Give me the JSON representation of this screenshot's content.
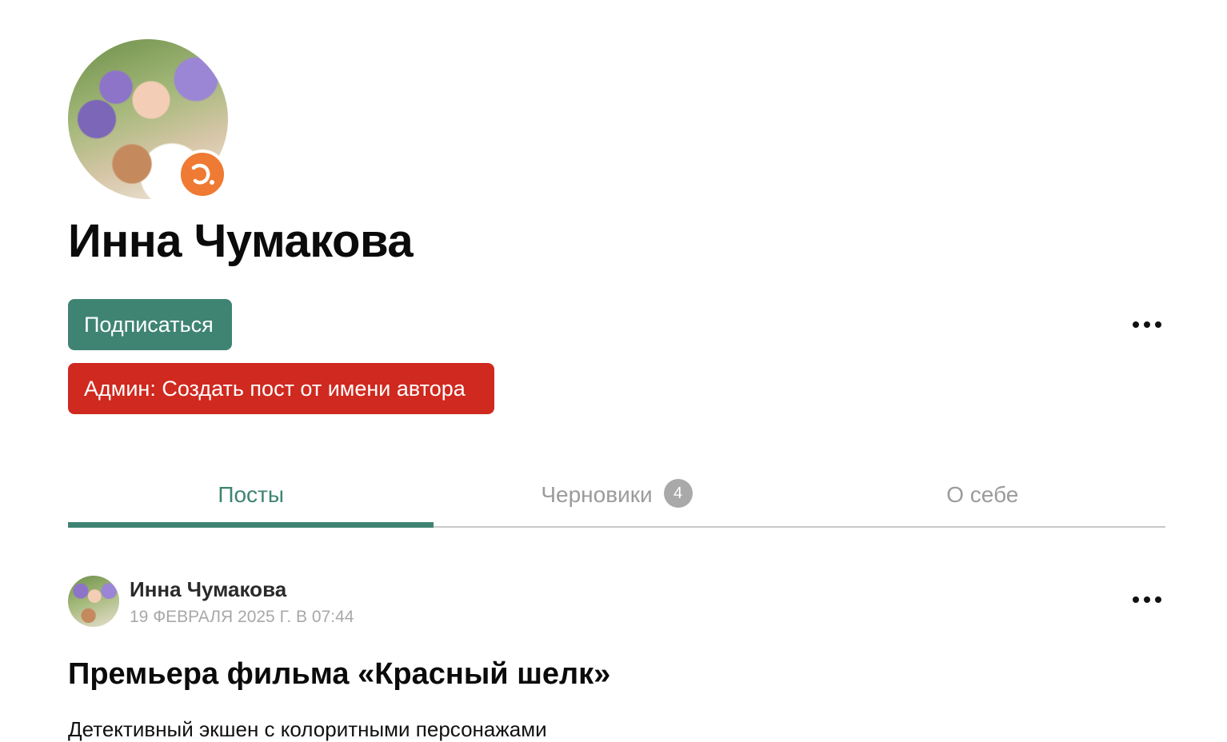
{
  "profile": {
    "name": "Инна Чумакова",
    "badge_icon": "orange-author-badge-icon",
    "subscribe_label": "Подписаться",
    "admin_create_label": "Админ: Создать пост от имени автора",
    "more_icon": "more-horizontal-icon"
  },
  "tabs": [
    {
      "label": "Посты",
      "active": true
    },
    {
      "label": "Черновики",
      "count": "4",
      "active": false
    },
    {
      "label": "О себе",
      "active": false
    }
  ],
  "post": {
    "author": "Инна Чумакова",
    "date": "19 ФЕВРАЛЯ 2025 Г. В 07:44",
    "title": "Премьера фильма «Красный шелк»",
    "subtitle": "Детективный экшен с колоритными персонажами"
  },
  "colors": {
    "accent_green": "#3f8473",
    "admin_red": "#d0291f",
    "badge_orange": "#ef7a33",
    "muted_gray": "#9b9b9b"
  }
}
